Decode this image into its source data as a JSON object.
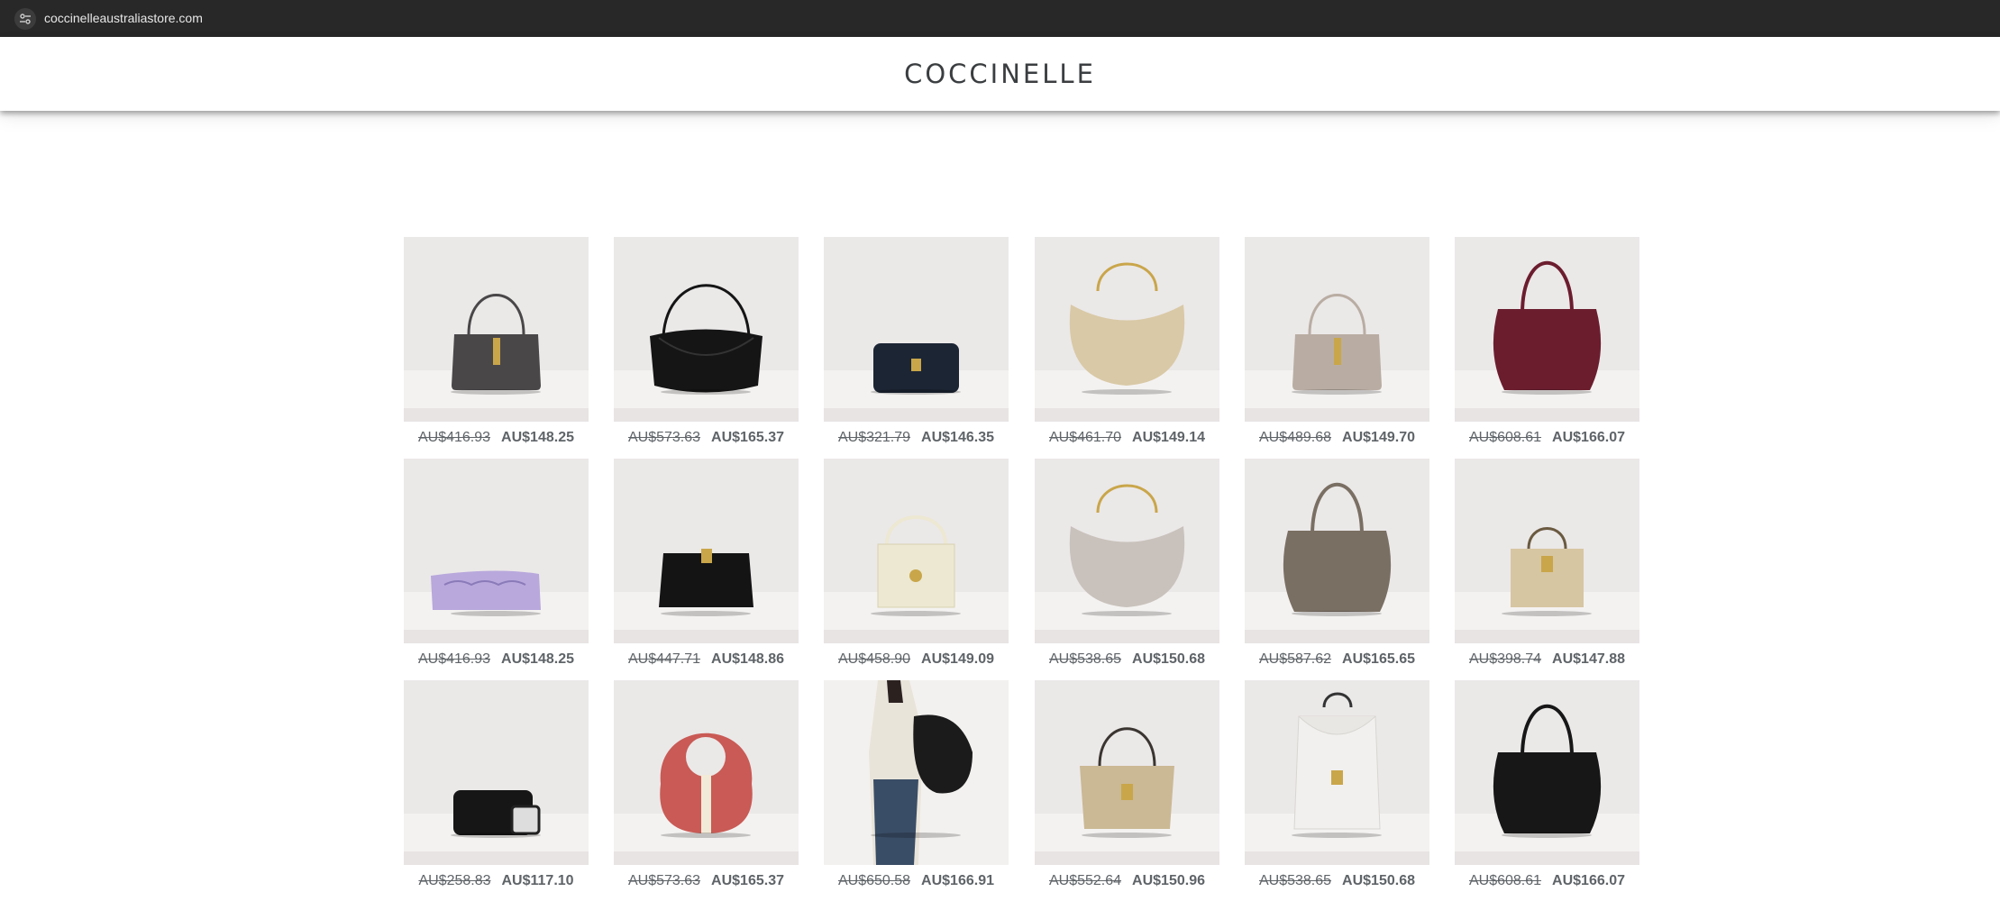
{
  "browser": {
    "url": "coccinelleaustraliastore.com",
    "site_icon": "tune-icon"
  },
  "header": {
    "logo": "COCCINELLE"
  },
  "products": [
    {
      "old_price": "AU$416.93",
      "price": "AU$148.25",
      "color": "#4a4749"
    },
    {
      "old_price": "AU$573.63",
      "price": "AU$165.37",
      "color": "#151515"
    },
    {
      "old_price": "AU$321.79",
      "price": "AU$146.35",
      "color": "#1c2534"
    },
    {
      "old_price": "AU$461.70",
      "price": "AU$149.14",
      "color": "#d9c9a6"
    },
    {
      "old_price": "AU$489.68",
      "price": "AU$149.70",
      "color": "#b9ada3"
    },
    {
      "old_price": "AU$608.61",
      "price": "AU$166.07",
      "color": "#6b1d2e"
    },
    {
      "old_price": "AU$416.93",
      "price": "AU$148.25",
      "color": "#b8a8dc"
    },
    {
      "old_price": "AU$447.71",
      "price": "AU$148.86",
      "color": "#141414"
    },
    {
      "old_price": "AU$458.90",
      "price": "AU$149.09",
      "color": "#ece8d2"
    },
    {
      "old_price": "AU$538.65",
      "price": "AU$150.68",
      "color": "#c9c2bc"
    },
    {
      "old_price": "AU$587.62",
      "price": "AU$165.65",
      "color": "#7a6f63"
    },
    {
      "old_price": "AU$398.74",
      "price": "AU$147.88",
      "color": "#d6c6a2"
    },
    {
      "old_price": "AU$258.83",
      "price": "AU$117.10",
      "color": "#161616"
    },
    {
      "old_price": "AU$573.63",
      "price": "AU$165.37",
      "color": "#c95a55"
    },
    {
      "old_price": "AU$650.58",
      "price": "AU$166.91",
      "color": "#1b1b1b"
    },
    {
      "old_price": "AU$552.64",
      "price": "AU$150.96",
      "color": "#cbb995"
    },
    {
      "old_price": "AU$538.65",
      "price": "AU$150.68",
      "color": "#f1f0ee"
    },
    {
      "old_price": "AU$608.61",
      "price": "AU$166.07",
      "color": "#171717"
    }
  ]
}
